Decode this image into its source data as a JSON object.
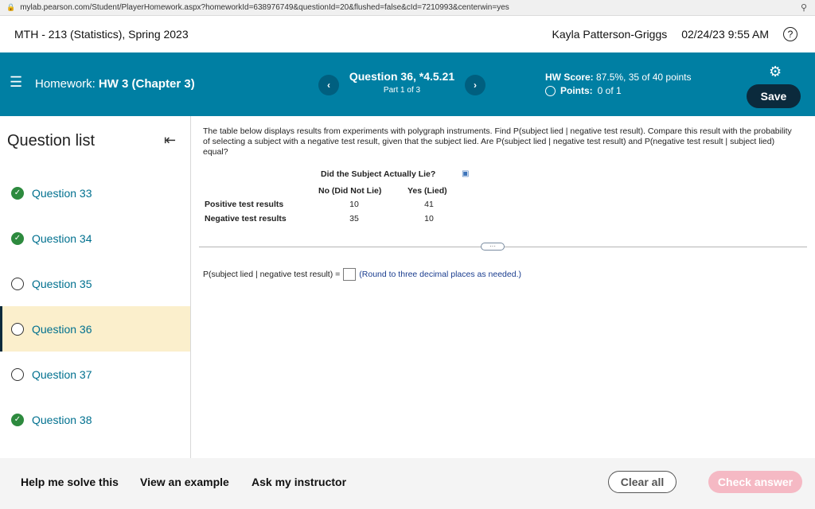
{
  "browser": {
    "url": "mylab.pearson.com/Student/PlayerHomework.aspx?homeworkId=638976749&questionId=20&flushed=false&cId=7210993&centerwin=yes"
  },
  "course": {
    "title": "MTH - 213 (Statistics), Spring 2023",
    "user": "Kayla Patterson-Griggs",
    "datetime": "02/24/23 9:55 AM"
  },
  "homework": {
    "label": "Homework:",
    "name": "HW 3 (Chapter 3)",
    "question_title": "Question 36, *4.5.21",
    "part": "Part 1 of 3",
    "score_label": "HW Score:",
    "score_value": "87.5%, 35 of 40 points",
    "points_label": "Points:",
    "points_value": "0 of 1",
    "save_label": "Save"
  },
  "sidebar": {
    "heading": "Question list",
    "items": [
      {
        "label": "Question 33",
        "status": "done"
      },
      {
        "label": "Question 34",
        "status": "done"
      },
      {
        "label": "Question 35",
        "status": "open"
      },
      {
        "label": "Question 36",
        "status": "current"
      },
      {
        "label": "Question 37",
        "status": "open"
      },
      {
        "label": "Question 38",
        "status": "done"
      }
    ]
  },
  "question": {
    "prompt": "The table below displays results from experiments with polygraph instruments. Find P(subject lied | negative test result). Compare this result with the probability of selecting a subject with a negative test result, given that the subject lied. Are P(subject lied | negative test result) and P(negative test result | subject lied) equal?",
    "table": {
      "title": "Did the Subject Actually Lie?",
      "col1": "No (Did Not Lie)",
      "col2": "Yes (Lied)",
      "rows": [
        {
          "label": "Positive test results",
          "v1": "10",
          "v2": "41"
        },
        {
          "label": "Negative test results",
          "v1": "35",
          "v2": "10"
        }
      ]
    },
    "answer_label": "P(subject lied | negative test result) =",
    "answer_value": "",
    "hint": "(Round to three decimal places as needed.)"
  },
  "footer": {
    "help": "Help me solve this",
    "example": "View an example",
    "instructor": "Ask my instructor",
    "clear": "Clear all",
    "check": "Check answer"
  }
}
